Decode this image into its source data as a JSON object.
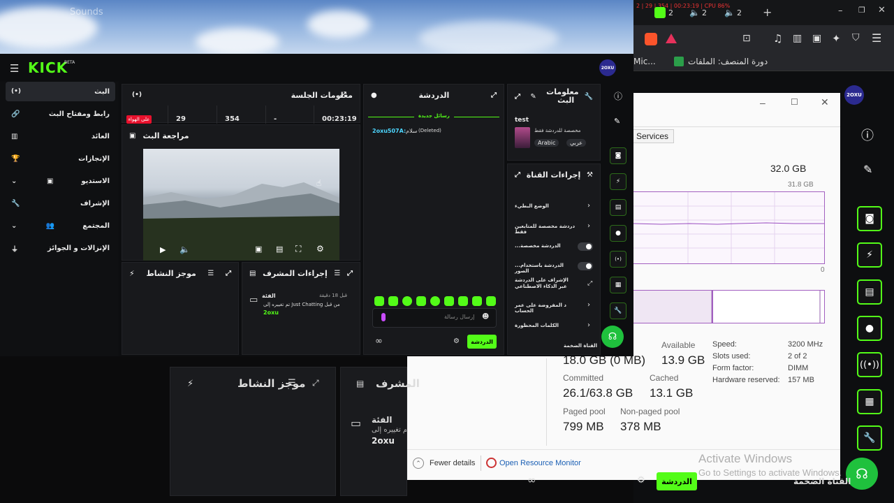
{
  "desktop": {
    "ghost_title": "Sounds"
  },
  "browser": {
    "title_strip": "2 | 29 | 354 | 00:23:19 | CPU 86%",
    "tab_count_1": "2",
    "tab_count_2": "2",
    "tab_count_3": "2",
    "bookmark_1": "Mic...",
    "bookmark_2": "دورة المنصف: الملفات"
  },
  "kick": {
    "logo": "KICK",
    "beta": "BETA",
    "avatar_text": "2OXU",
    "sidebar": [
      {
        "label": "البث",
        "icon": "live-icon"
      },
      {
        "label": "رابط ومفتاح البث",
        "icon": "link-icon"
      },
      {
        "label": "العائد",
        "icon": "chart-icon"
      },
      {
        "label": "الإنجازات",
        "icon": "trophy-icon"
      },
      {
        "label": "الاستديو",
        "icon": "studio-icon"
      },
      {
        "label": "الإشراف",
        "icon": "wrench-icon"
      },
      {
        "label": "المجتمع",
        "icon": "community-icon"
      },
      {
        "label": "الإنزالات و الجوائز",
        "icon": "drops-icon"
      }
    ],
    "session": {
      "title": "معلومات الجلسة",
      "live_badge": "على الهواء",
      "viewers": "29",
      "followers": "354",
      "dash": "-",
      "duration": "00:23:19"
    },
    "preview": {
      "title": "مراجعة البث"
    },
    "activity": {
      "title": "موجز النشاط"
    },
    "modactions": {
      "title": "إجراءات المشرف",
      "time": "قبل 18 دقيقة",
      "label": "الفئة",
      "text": "تم تغييره إلى Just Chatting من قبل",
      "user": "2oxu"
    },
    "chat": {
      "title": "الدردشة",
      "new_messages": "رسائل جديدة",
      "msg_user": "2oxu507A:",
      "msg_text": "سلام",
      "msg_deleted": "(Deleted)",
      "input_placeholder": "إرسال رسالة",
      "send_label": "الدردشة"
    },
    "streaminfo": {
      "title": "معلومات البث",
      "stream_title": "test",
      "category": "مخصصة للدردشة فقط",
      "tag_1": "Arabic",
      "tag_2": "عربي"
    },
    "channel_actions": {
      "title": "إجراءات القناة",
      "items": [
        "الوضع البطيء",
        "دردشة مخصصة للمتابعين فقط",
        "...الدردشة مخصصة",
        "...الدردشة باستخدام الصور",
        "الإشراف على الدردشة عبر الذكاء الاصطناعي",
        "د المفروضة على عمر الحساب",
        "الكلمات المحظورة",
        "القناة الضخمة"
      ]
    }
  },
  "taskmgr": {
    "tab": "Services",
    "total": "32.0 GB",
    "chart_max": "31.8 GB",
    "chart_min": "0",
    "in_use_label": "",
    "in_use_value": "18.0 GB (0 MB)",
    "available_label": "Available",
    "available_value": "13.9 GB",
    "committed_label": "Committed",
    "committed_value": "26.1/63.8 GB",
    "cached_label": "Cached",
    "cached_value": "13.1 GB",
    "paged_label": "Paged pool",
    "paged_value": "799 MB",
    "nonpaged_label": "Non-paged pool",
    "nonpaged_value": "378 MB",
    "speed_label": "Speed:",
    "speed_value": "3200 MHz",
    "slots_label": "Slots used:",
    "slots_value": "2 of 2",
    "form_label": "Form factor:",
    "form_value": "DIMM",
    "hwres_label": "Hardware reserved:",
    "hwres_value": "157 MB",
    "fewer_details": "Fewer details",
    "resource_monitor": "Open Resource Monitor"
  },
  "windows_watermark": {
    "line1": "Activate Windows",
    "line2": "Go to Settings to activate Windows."
  },
  "ghost": {
    "activity": "موجز النشاط",
    "mod": "المشرف",
    "category": "الفئة",
    "changed": "تم تغييره إلى",
    "user": "2oxu",
    "chat_btn": "الدردشة",
    "big_channel": "القناة الضخمة"
  },
  "colors": {
    "brand": "#53fc18",
    "live": "#e8112d"
  }
}
